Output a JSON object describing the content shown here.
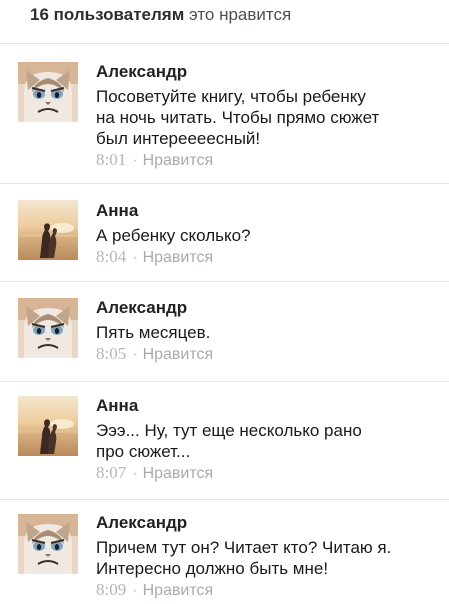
{
  "likes": {
    "count": "16 пользователям",
    "suffix": "это нравится"
  },
  "comments": [
    {
      "author": "Александр",
      "text": "Посоветуйте книгу, чтобы ребенку\nна ночь читать. Чтобы прямо сюжет\nбыл интереееесный!",
      "time": "8:01",
      "like_label": "Нравится",
      "avatar": "grumpy-cat"
    },
    {
      "author": "Анна",
      "text": "А ребенку сколько?",
      "time": "8:04",
      "like_label": "Нравится",
      "avatar": "couple-sunset"
    },
    {
      "author": "Александр",
      "text": "Пять месяцев.",
      "time": "8:05",
      "like_label": "Нравится",
      "avatar": "grumpy-cat"
    },
    {
      "author": "Анна",
      "text": "Эээ... Ну, тут еще несколько рано\nпро сюжет...",
      "time": "8:07",
      "like_label": "Нравится",
      "avatar": "couple-sunset"
    },
    {
      "author": "Александр",
      "text": "Причем тут он? Читает кто? Читаю я.\nИнтересно должно быть мне!",
      "time": "8:09",
      "like_label": "Нравится",
      "avatar": "grumpy-cat"
    }
  ],
  "colors": {
    "author": "#222222",
    "meta": "#b2b6bc",
    "divider": "#e5e6e9"
  }
}
